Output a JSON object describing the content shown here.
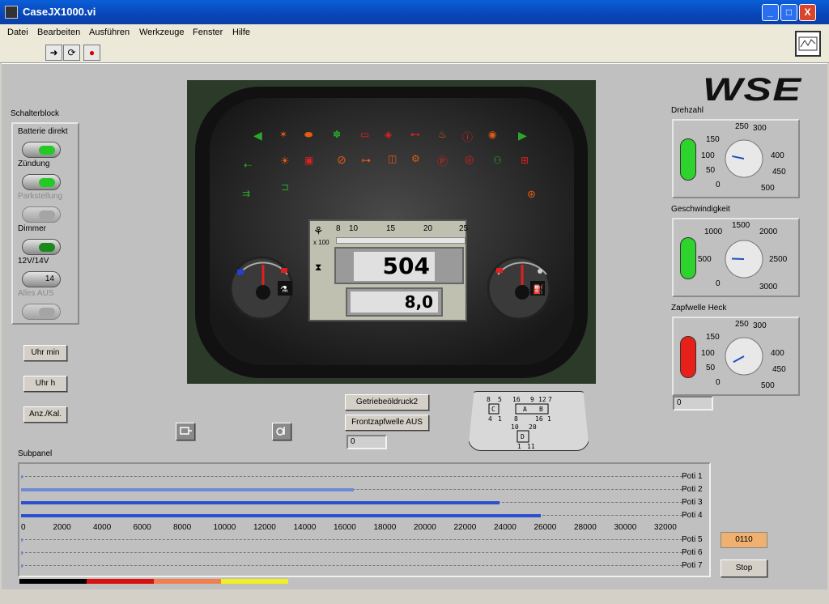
{
  "window": {
    "title": "CaseJX1000.vi",
    "minimize": "_",
    "maximize": "□",
    "close": "X"
  },
  "menu": [
    "Datei",
    "Bearbeiten",
    "Ausführen",
    "Werkzeuge",
    "Fenster",
    "Hilfe"
  ],
  "toolbar": {
    "run": "➜",
    "run_continuous": "⟳",
    "abort": "●"
  },
  "logo": "WSE",
  "switch_block": {
    "title": "Schalterblock",
    "switches": [
      {
        "label": "Batterie direkt",
        "enabled": true,
        "on": true
      },
      {
        "label": "Zündung",
        "enabled": true,
        "on": true
      },
      {
        "label": "Parkstellung",
        "enabled": false,
        "on": false
      },
      {
        "label": "Dimmer",
        "enabled": true,
        "on": true
      },
      {
        "label": "12V/14V",
        "enabled": true,
        "value": "14"
      },
      {
        "label": "Alles AUS",
        "enabled": false,
        "on": false
      }
    ]
  },
  "buttons": {
    "uhr_min": "Uhr min",
    "uhr_h": "Uhr h",
    "anz_kal": "Anz./Kal.",
    "getriebe": "Getriebeöldruck2",
    "frontzapf": "Frontzapfwelle AUS",
    "stop": "Stop"
  },
  "dashboard": {
    "scale_ticks": [
      "8",
      "10",
      "15",
      "20",
      "25"
    ],
    "scale_unit": "x 100",
    "rpm_display": "504",
    "speed_display": "8,0"
  },
  "frontzapf_value": "0",
  "gear_diagram": {
    "labels": [
      "8",
      "5",
      "16",
      "9",
      "12",
      "7",
      "C",
      "A",
      "B",
      "4",
      "1",
      "8",
      "16",
      "1",
      "10",
      "20",
      "D",
      "1",
      "11"
    ]
  },
  "knobs": [
    {
      "title": "Drehzahl",
      "led_color": "#2ed32e",
      "ticks": [
        "150",
        "250",
        "300",
        "100",
        "400",
        "50",
        "450",
        "0",
        "500"
      ],
      "value": 105
    },
    {
      "title": "Geschwindigkeit",
      "led_color": "#2ed32e",
      "ticks": [
        "1500",
        "1000",
        "2000",
        "500",
        "2500",
        "0",
        "3000"
      ],
      "value": 520
    },
    {
      "title": "Zapfwelle Heck",
      "led_color": "#e8201a",
      "ticks": [
        "150",
        "250",
        "300",
        "100",
        "400",
        "50",
        "450",
        "0",
        "500"
      ],
      "value": 30,
      "field": "0"
    }
  ],
  "subpanel": {
    "title": "Subpanel",
    "axis": [
      "0",
      "2000",
      "4000",
      "6000",
      "8000",
      "10000",
      "12000",
      "14000",
      "16000",
      "18000",
      "20000",
      "22000",
      "24000",
      "26000",
      "28000",
      "30000",
      "32000"
    ],
    "axis_max": 32000,
    "potis": [
      {
        "label": "Poti 1",
        "value": 0,
        "dim": true
      },
      {
        "label": "Poti 2",
        "value": 16000,
        "dim": true
      },
      {
        "label": "Poti 3",
        "value": 23000,
        "dim": false
      },
      {
        "label": "Poti 4",
        "value": 25000,
        "dim": false
      },
      {
        "label": "Poti 5",
        "value": 0,
        "dim": true
      },
      {
        "label": "Poti 6",
        "value": 0,
        "dim": true
      },
      {
        "label": "Poti 7",
        "value": 0,
        "dim": true
      }
    ],
    "code_display": "0110"
  },
  "legend_colors": [
    "#000000",
    "#d81010",
    "#f08050",
    "#f0f020"
  ]
}
